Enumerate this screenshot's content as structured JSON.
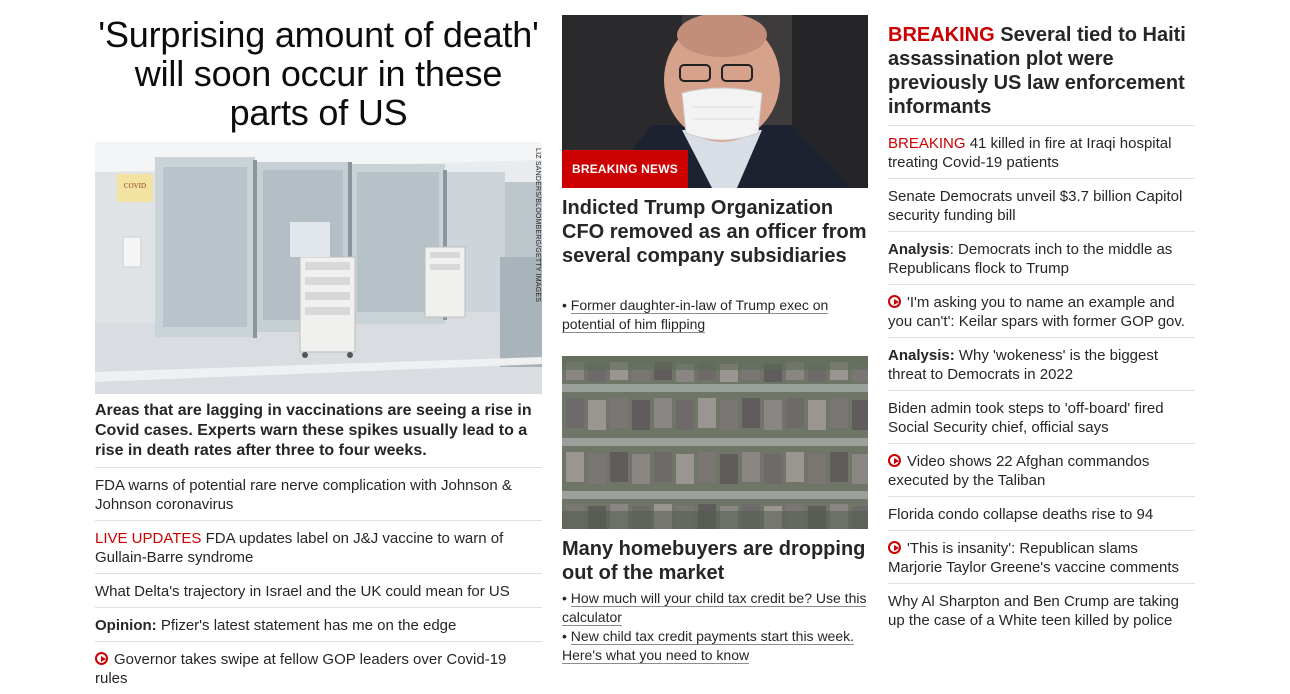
{
  "col1": {
    "headline": "'Surprising amount of death' will soon occur in these parts of US",
    "image_credit": "LIZ SANDERS/BLOOMBERG/GETTY IMAGES",
    "image_sign": "COVID",
    "description": "Areas that are lagging in vaccinations are seeing a rise in Covid cases. Experts warn these spikes usually lead to a rise in death rates after three to four weeks.",
    "items": [
      {
        "prefix": "",
        "text": "FDA warns of potential rare nerve complication with Johnson & Johnson coronavirus"
      },
      {
        "prefix": "LIVE UPDATES",
        "text": " FDA updates label on J&J vaccine to warn of Gullain-Barre syndrome"
      },
      {
        "prefix": "",
        "text": "What Delta's trajectory in Israel and the UK could mean for US"
      },
      {
        "prefix": "Opinion:",
        "text": " Pfizer's latest statement has me on the edge"
      },
      {
        "prefix": "",
        "text": "Governor takes swipe at fellow GOP leaders over Covid-19 rules",
        "icon": "play-icon"
      }
    ]
  },
  "col2": {
    "story1": {
      "badge": "BREAKING NEWS",
      "title": "Indicted Trump Organization CFO removed as an officer from several company subsidiaries",
      "links": [
        "Former daughter-in-law of Trump exec on potential of him flipping"
      ]
    },
    "story2": {
      "title": "Many homebuyers are dropping out of the market",
      "links": [
        "How much will your child tax credit be? Use this calculator",
        "New child tax credit payments start this week. Here's what you need to know"
      ]
    }
  },
  "col3": {
    "breaking_label": "BREAKING",
    "breaking_title": " Several tied to Haiti assassination plot were previously US law enforcement informants",
    "items": [
      {
        "prefix": "BREAKING",
        "text": " 41 killed in fire at Iraqi hospital treating Covid-19 patients",
        "style": "red"
      },
      {
        "prefix": "",
        "text": "Senate Democrats unveil $3.7 billion Capitol security funding bill"
      },
      {
        "prefix": "Analysis",
        "text": ": Democrats inch to the middle as Republicans flock to Trump",
        "style": "bold"
      },
      {
        "prefix": "",
        "text": "'I'm asking you to name an example and you can't': Keilar spars with former GOP gov.",
        "icon": "play-icon"
      },
      {
        "prefix": "Analysis:",
        "text": " Why 'wokeness' is the biggest threat to Democrats in 2022",
        "style": "bold"
      },
      {
        "prefix": "",
        "text": "Biden admin took steps to 'off-board' fired Social Security chief, official says"
      },
      {
        "prefix": "",
        "text": "Video shows 22 Afghan commandos executed by the Taliban",
        "icon": "play-icon"
      },
      {
        "prefix": "",
        "text": "Florida condo collapse deaths rise to 94"
      },
      {
        "prefix": "",
        "text": "'This is insanity': Republican slams Marjorie Taylor Greene's vaccine comments",
        "icon": "play-icon"
      },
      {
        "prefix": "",
        "text": "Why Al Sharpton and Ben Crump are taking up the case of a White teen killed by police"
      }
    ]
  },
  "colors": {
    "accent_red": "#cc0000",
    "text": "#262626",
    "divider": "#e0e0e0"
  }
}
